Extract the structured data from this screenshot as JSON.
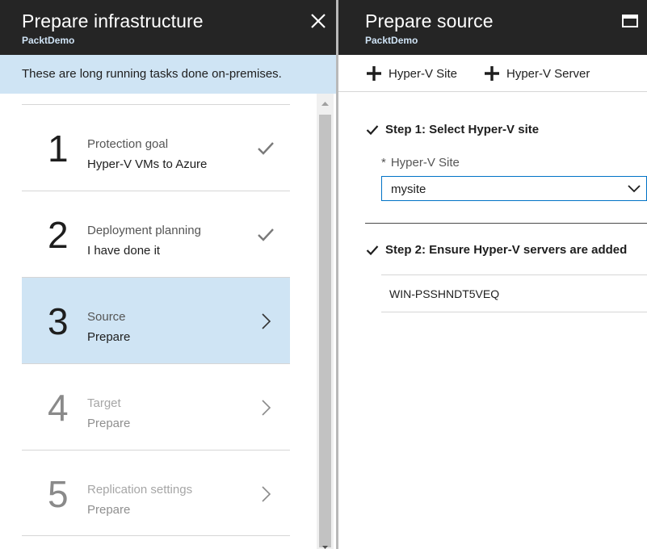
{
  "left_blade": {
    "title": "Prepare infrastructure",
    "subtitle": "PacktDemo",
    "close_icon": "close-icon",
    "banner": "These are long running tasks done on-premises.",
    "steps": [
      {
        "number": "1",
        "title": "Protection goal",
        "subtitle": "Hyper-V VMs to Azure",
        "status": "completed",
        "icon": "checkmark-icon"
      },
      {
        "number": "2",
        "title": "Deployment planning",
        "subtitle": "I have done it",
        "status": "completed",
        "icon": "checkmark-icon"
      },
      {
        "number": "3",
        "title": "Source",
        "subtitle": "Prepare",
        "status": "active",
        "icon": "chevron-right-icon"
      },
      {
        "number": "4",
        "title": "Target",
        "subtitle": "Prepare",
        "status": "disabled",
        "icon": "chevron-right-icon"
      },
      {
        "number": "5",
        "title": "Replication settings",
        "subtitle": "Prepare",
        "status": "disabled",
        "icon": "chevron-right-icon"
      }
    ]
  },
  "right_blade": {
    "title": "Prepare source",
    "subtitle": "PacktDemo",
    "maximize_icon": "maximize-icon",
    "toolbar": {
      "add_site_label": "Hyper-V Site",
      "add_server_label": "Hyper-V Server"
    },
    "step1": {
      "title": "Step 1: Select Hyper-V site",
      "field_required_marker": "*",
      "field_label": "Hyper-V Site",
      "selected_value": "mysite"
    },
    "step2": {
      "title": "Step 2: Ensure Hyper-V servers are added",
      "servers": [
        "WIN-PSSHNDT5VEQ"
      ]
    }
  },
  "colors": {
    "header_bg": "#252525",
    "accent_light_blue": "#cfe4f4",
    "select_border": "#0072c6",
    "subtitle_blue": "#cfe3f5"
  }
}
